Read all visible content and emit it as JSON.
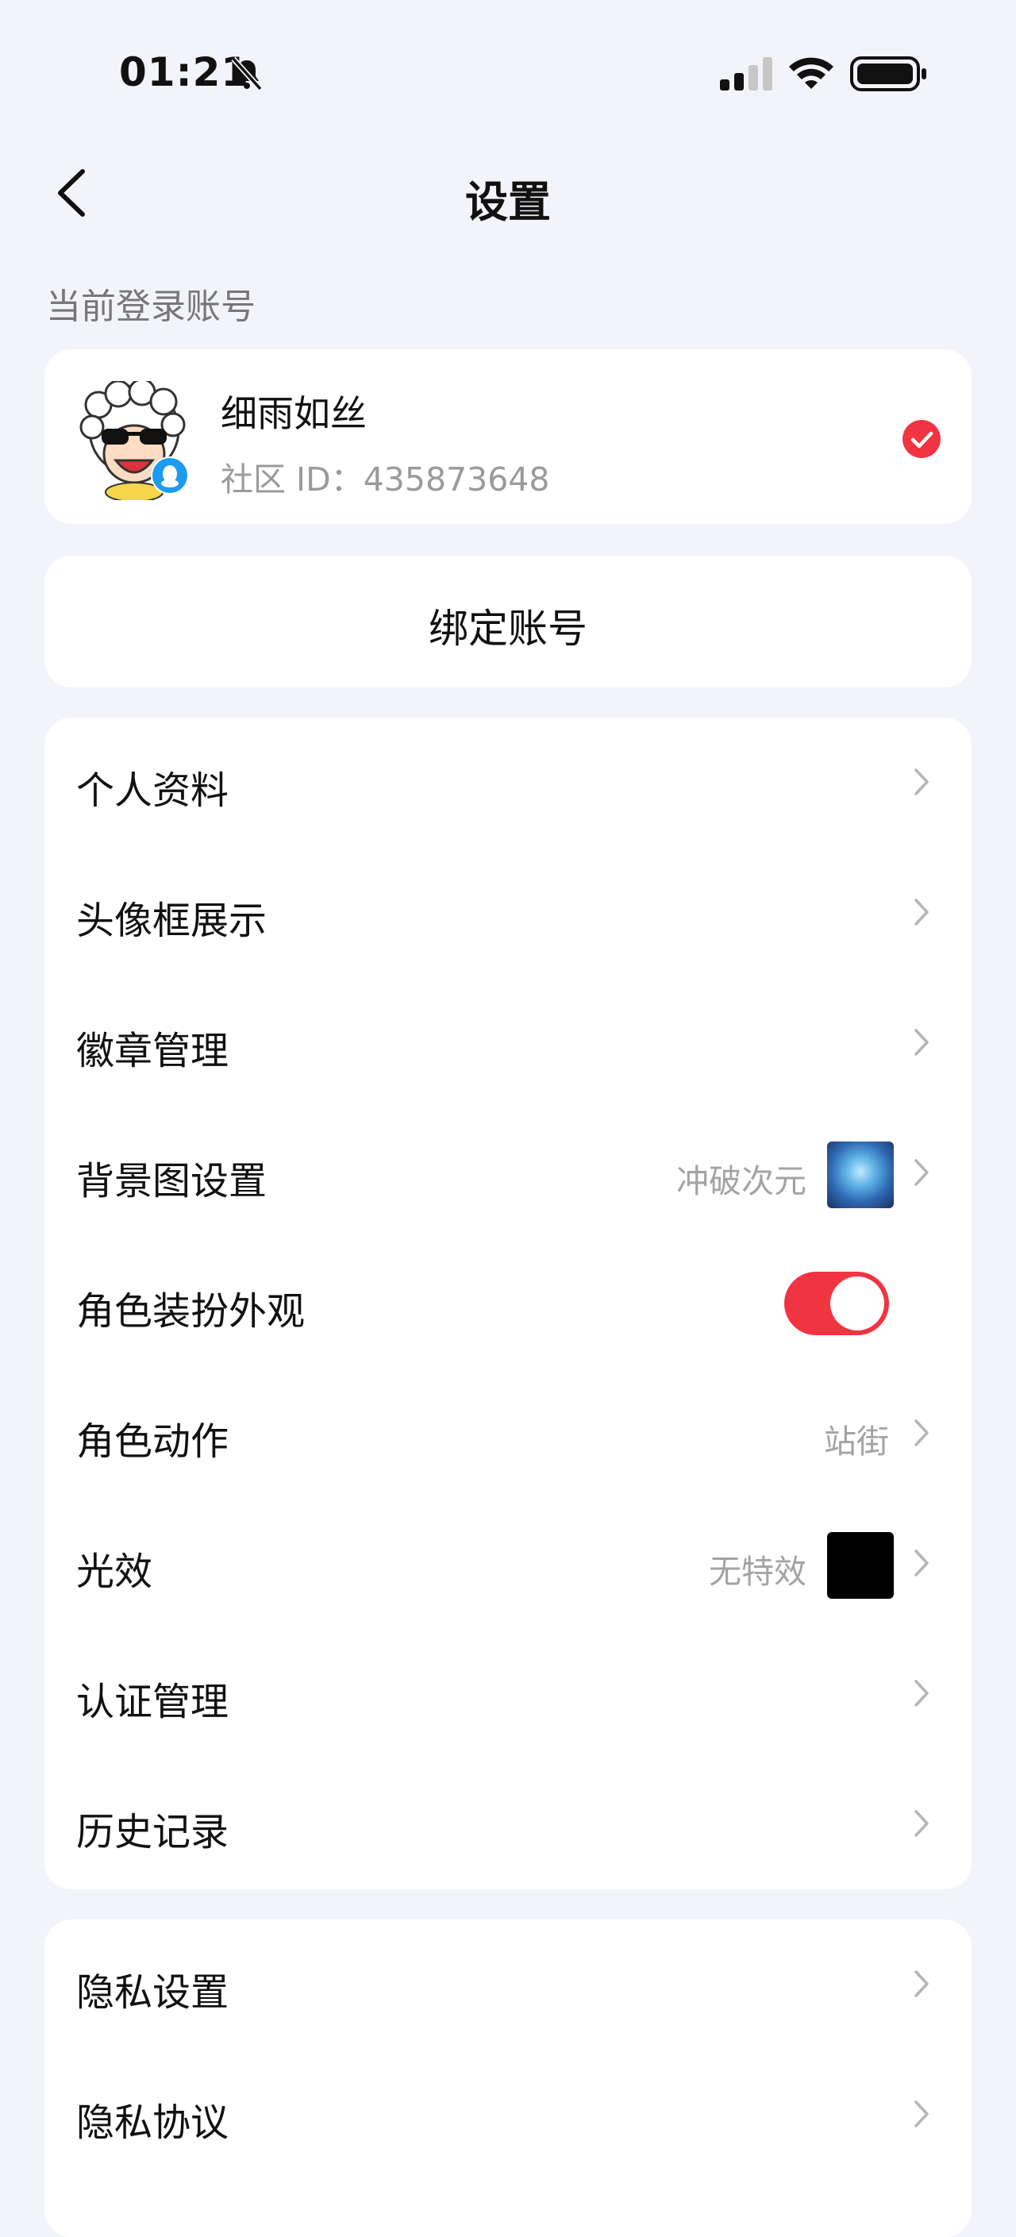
{
  "status_bar": {
    "time": "01:21"
  },
  "nav": {
    "title": "设置"
  },
  "current_account_label": "当前登录账号",
  "account": {
    "name": "细雨如丝",
    "id_text": "社区 ID：435873648"
  },
  "bind_account_label": "绑定账号",
  "menu": [
    {
      "label": "个人资料"
    },
    {
      "label": "头像框展示"
    },
    {
      "label": "徽章管理"
    },
    {
      "label": "背景图设置",
      "value": "冲破次元"
    },
    {
      "label": "角色装扮外观",
      "toggle_on": true
    },
    {
      "label": "角色动作",
      "value": "站街"
    },
    {
      "label": "光效",
      "value": "无特效"
    },
    {
      "label": "认证管理"
    },
    {
      "label": "历史记录"
    }
  ],
  "menu2": [
    {
      "label": "隐私设置"
    },
    {
      "label": "隐私协议"
    }
  ],
  "colors": {
    "accent_red": "#f03442",
    "background": "#f2f4f9",
    "qq_blue": "#1d9bf0"
  }
}
